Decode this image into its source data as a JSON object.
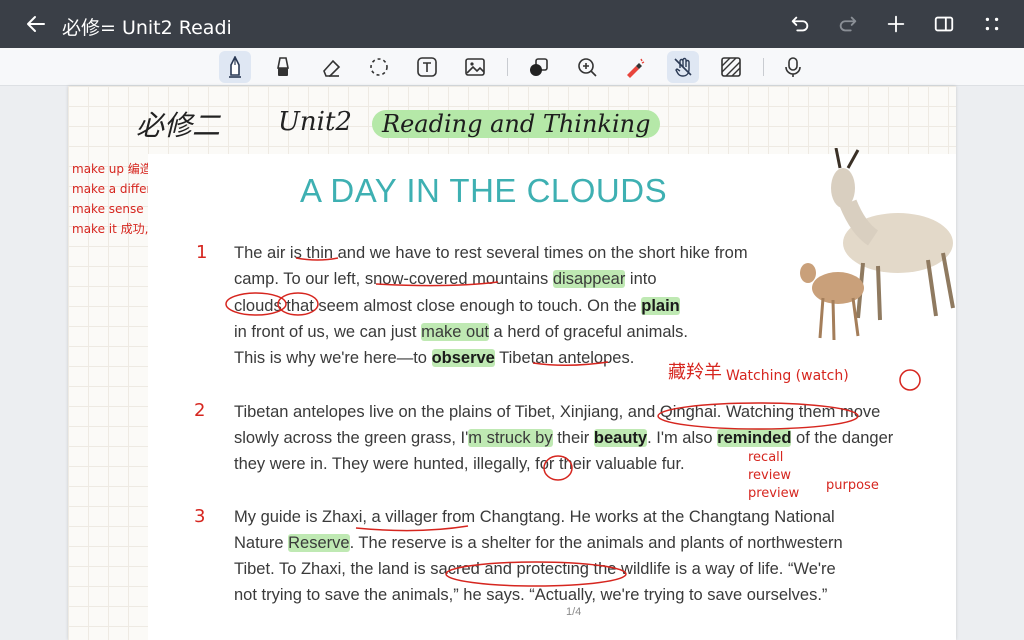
{
  "app": {
    "doc_title": "必修= Unit2 Readi"
  },
  "icons": {
    "back": "arrow-left-icon",
    "undo": "undo-icon",
    "redo": "redo-icon",
    "add": "plus-icon",
    "panel": "split-panel-icon",
    "more": "more-dots-icon"
  },
  "toolbar": {
    "tools": [
      "pen",
      "highlighter",
      "eraser",
      "lasso",
      "text",
      "image",
      "shapes",
      "zoom",
      "laser-pointer",
      "hand-touch",
      "pattern",
      "microphone"
    ]
  },
  "colors": {
    "accent_title": "#3eb0b2",
    "annotation": "#d6261f",
    "highlight": "#bfe9b3",
    "titlebar": "#3a3f47"
  },
  "notes": {
    "handwritten_title": "必修二",
    "unit": "Unit2",
    "section": "Reading and Thinking",
    "left_margin": [
      "make up 编造,组成",
      "make a difference 有影响",
      "make sense 有意义",
      "make it 成功,做到"
    ],
    "watching": "Watching (watch)",
    "zangling": "藏羚羊",
    "reasons": [
      "recall",
      "review",
      "preview",
      "purpose"
    ]
  },
  "article": {
    "title": "A DAY IN THE CLOUDS",
    "p1": {
      "num": "1",
      "l1": "The air is thin and we have to rest several times on the short hike from",
      "l2a": "camp. To our left, snow-covered mountains ",
      "l2b": "disappear",
      "l2c": " into",
      "l3a": "clouds that seem almost close enough to touch. On the ",
      "l3b": "plain",
      "l4a": "in front of us, we can just ",
      "l4b": "make out",
      "l4c": " a herd of graceful animals.",
      "l5a": "This is why we're here—to ",
      "l5b": "observe",
      "l5c": " Tibetan antelopes."
    },
    "p2": {
      "num": "2",
      "l1": "Tibetan antelopes live on the plains of Tibet, Xinjiang, and Qinghai. Watching them move",
      "l2a": "slowly across the green grass, I'",
      "l2b": "m struck by",
      "l2c": " their ",
      "l2d": "beauty",
      "l2e": ". I'm also ",
      "l2f": "reminded",
      "l2g": " of the danger",
      "l3": "they were in. They were hunted, illegally, for their valuable fur."
    },
    "p3": {
      "num": "3",
      "l1": "My guide is Zhaxi, a villager from Changtang. He works at the Changtang National",
      "l2a": "Nature ",
      "l2b": "Reserve",
      "l2c": ". The reserve is a shelter for the animals and plants of northwestern",
      "l3": "Tibet. To Zhaxi, the land is sacred and protecting the wildlife is a way of life. “We're",
      "l4": "not trying to save the animals,” he says. “Actually, we're trying to save ourselves.”"
    },
    "page_indicator": "1/4"
  }
}
